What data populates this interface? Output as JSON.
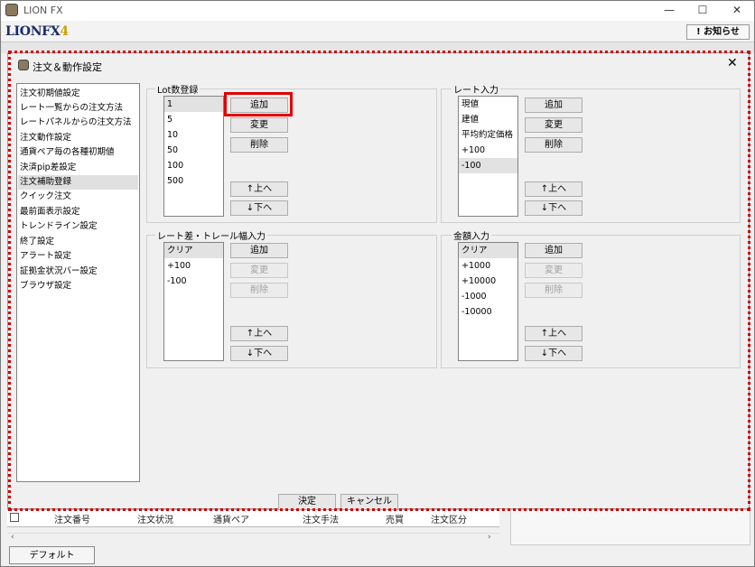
{
  "window": {
    "title": "LION FX",
    "logo_text": "LIONFX",
    "logo_version": "4",
    "notice_button": "! お知らせ",
    "min": "—",
    "max": "☐",
    "close": "✕"
  },
  "background_table": {
    "columns": [
      "注文番号",
      "注文状況",
      "通貨ペア",
      "注文手法",
      "売買",
      "注文区分"
    ],
    "tab": "デフォルト"
  },
  "dialog": {
    "title": "注文＆動作設定",
    "close": "✕",
    "nav_items": [
      "注文初期値設定",
      "レート一覧からの注文方法",
      "レートパネルからの注文方法",
      "注文動作設定",
      "通貨ペア毎の各種初期値",
      "決済pip差設定",
      "注文補助登録",
      "クイック注文",
      "最前面表示設定",
      "トレンドライン設定",
      "終了設定",
      "アラート設定",
      "証拠金状況バー設定",
      "ブラウザ設定"
    ],
    "nav_selected": "注文補助登録",
    "groups": {
      "lot": {
        "label": "Lot数登録",
        "items": [
          "1",
          "5",
          "10",
          "50",
          "100",
          "500"
        ],
        "selected": "1",
        "buttons": {
          "add": "追加",
          "edit": "変更",
          "delete": "削除",
          "up": "↑上へ",
          "down": "↓下へ"
        }
      },
      "rate": {
        "label": "レート入力",
        "items": [
          "現値",
          "建値",
          "平均約定価格",
          "+100",
          "-100"
        ],
        "selected": "-100",
        "buttons": {
          "add": "追加",
          "edit": "変更",
          "delete": "削除",
          "up": "↑上へ",
          "down": "↓下へ"
        }
      },
      "trail": {
        "label": "レート差・トレール幅入力",
        "items": [
          "クリア",
          "+100",
          "-100"
        ],
        "selected": "クリア",
        "buttons": {
          "add": "追加",
          "edit": "変更",
          "delete": "削除",
          "up": "↑上へ",
          "down": "↓下へ"
        }
      },
      "amount": {
        "label": "金額入力",
        "items": [
          "クリア",
          "+1000",
          "+10000",
          "-1000",
          "-10000"
        ],
        "selected": "クリア",
        "buttons": {
          "add": "追加",
          "edit": "変更",
          "delete": "削除",
          "up": "↑上へ",
          "down": "↓下へ"
        }
      }
    },
    "ok": "決定",
    "cancel": "キャンセル"
  },
  "colors": {
    "highlight": "#e00000",
    "selection": "#e0e0e0"
  }
}
